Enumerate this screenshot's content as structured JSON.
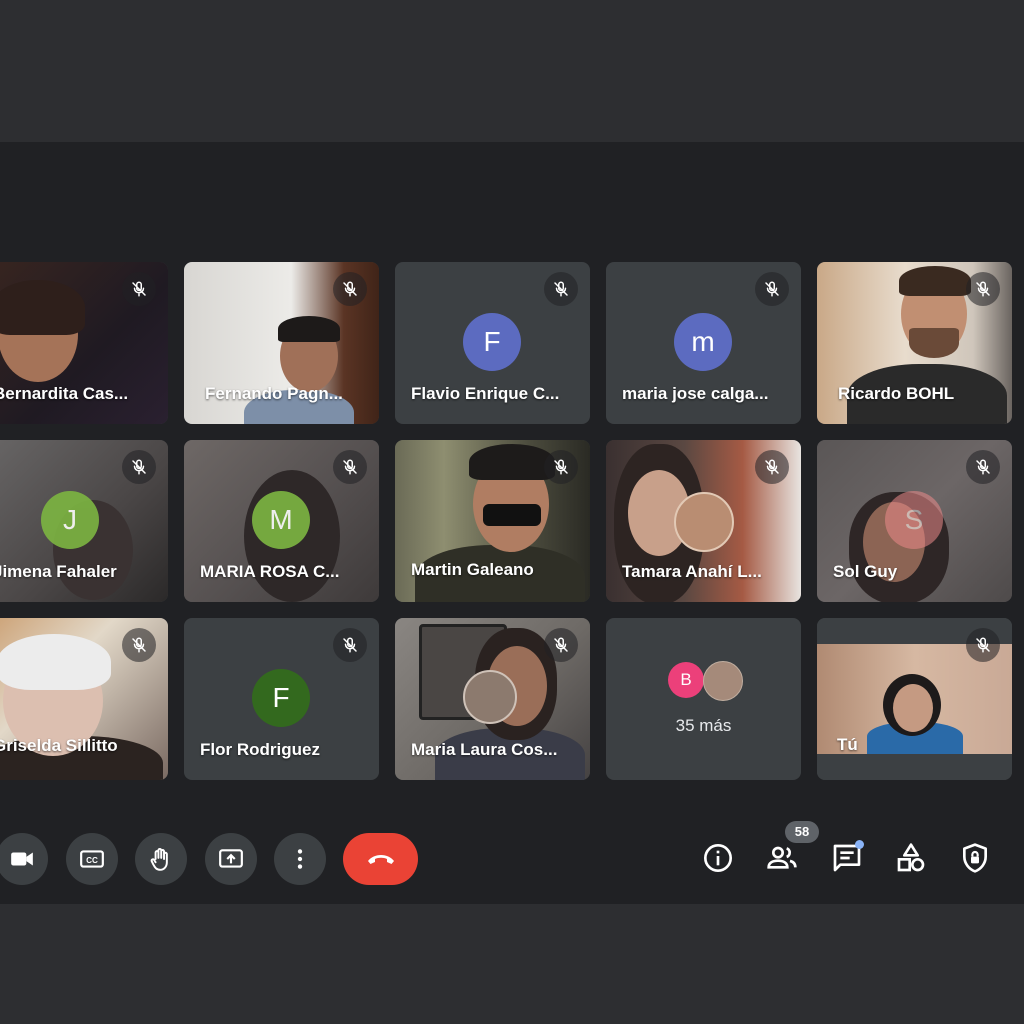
{
  "participants": [
    {
      "name": "Bernardita Cas...",
      "muted": true,
      "type": "video"
    },
    {
      "name": "Fernando Pagn...",
      "muted": true,
      "type": "video"
    },
    {
      "name": "Flavio Enrique C...",
      "muted": true,
      "type": "avatar",
      "initial": "F",
      "color": "#5c6bc0"
    },
    {
      "name": "maria jose calga...",
      "muted": true,
      "type": "avatar",
      "initial": "m",
      "color": "#5c6bc0"
    },
    {
      "name": "Ricardo BOHL",
      "muted": true,
      "type": "video"
    },
    {
      "name": "Jimena Fahaler",
      "muted": true,
      "type": "avatar-over-video",
      "initial": "J",
      "color": "#7cb342"
    },
    {
      "name": "MARIA ROSA C...",
      "muted": true,
      "type": "avatar-over-video",
      "initial": "M",
      "color": "#7cb342"
    },
    {
      "name": "Martin Galeano",
      "muted": true,
      "type": "video"
    },
    {
      "name": "Tamara Anahí L...",
      "muted": true,
      "type": "video"
    },
    {
      "name": "Sol Guy",
      "muted": true,
      "type": "avatar-over-video",
      "initial": "S",
      "color": "#ec8a8a"
    },
    {
      "name": "Griselda Sillitto",
      "muted": true,
      "type": "video"
    },
    {
      "name": "Flor Rodriguez",
      "muted": true,
      "type": "avatar",
      "initial": "F",
      "color": "#33691e"
    },
    {
      "name": "Maria Laura Cos...",
      "muted": true,
      "type": "video"
    },
    {
      "name": "35 más",
      "type": "overflow",
      "initial": "B",
      "color": "#ec407a"
    },
    {
      "name": "Tú",
      "muted": true,
      "type": "self-video"
    }
  ],
  "controls": {
    "left": [
      "camera-icon",
      "captions-icon",
      "raise-hand-icon",
      "present-screen-icon",
      "more-options-icon",
      "end-call-icon"
    ],
    "right": [
      "info-icon",
      "people-icon",
      "chat-icon",
      "activities-icon",
      "host-controls-icon"
    ]
  },
  "people_count": "58",
  "colors": {
    "background": "#202124",
    "tile": "#3c4043",
    "end_call": "#ea4335",
    "chat_dot": "#8ab4f8"
  }
}
